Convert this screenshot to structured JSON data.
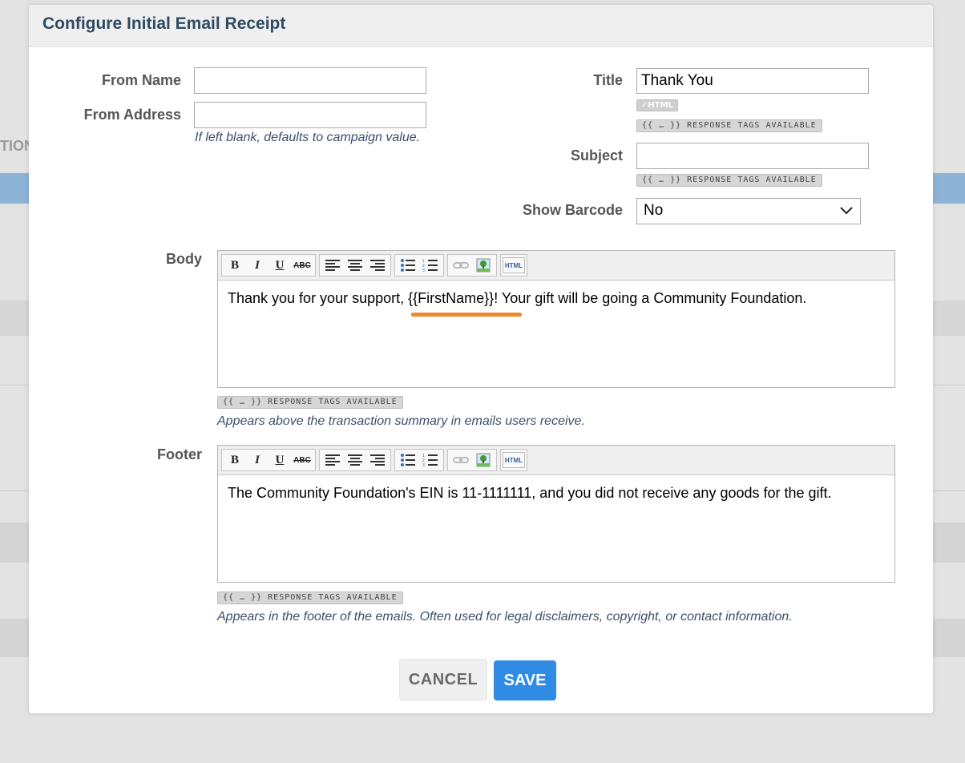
{
  "background": {
    "partial_heading": "TION"
  },
  "modal": {
    "title": "Configure Initial Email Receipt",
    "from_name": {
      "label": "From Name",
      "value": ""
    },
    "from_address": {
      "label": "From Address",
      "value": ""
    },
    "from_hint": "If left blank, defaults to campaign value.",
    "title_field": {
      "label": "Title",
      "value": "Thank You"
    },
    "html_badge": "✓HTML",
    "response_tags": "{{ … }} RESPONSE TAGS AVAILABLE",
    "subject": {
      "label": "Subject",
      "value": ""
    },
    "show_barcode": {
      "label": "Show Barcode",
      "selected": "No"
    },
    "body": {
      "label": "Body",
      "before": "Thank you for your support, ",
      "tag": "{{FirstName}}",
      "after": "! Your gift will be going a Community Foundation.",
      "hint": "Appears above the transaction summary in emails users receive."
    },
    "footer": {
      "label": "Footer",
      "content": "The Community Foundation's EIN is 11-1111111, and you did not receive any goods for the gift.",
      "hint": "Appears in the footer of the emails. Often used for legal disclaimers, copyright, or contact information."
    },
    "toolbar": {
      "bold": "B",
      "italic": "I",
      "underline": "U",
      "strike": "ABC",
      "html": "HTML"
    },
    "buttons": {
      "cancel": "CANCEL",
      "save": "SAVE"
    }
  },
  "colors": {
    "title": "#2e4a63",
    "save_button": "#2f8be3",
    "highlight_underline": "#f08a2c",
    "hint_text": "#3a5068"
  }
}
